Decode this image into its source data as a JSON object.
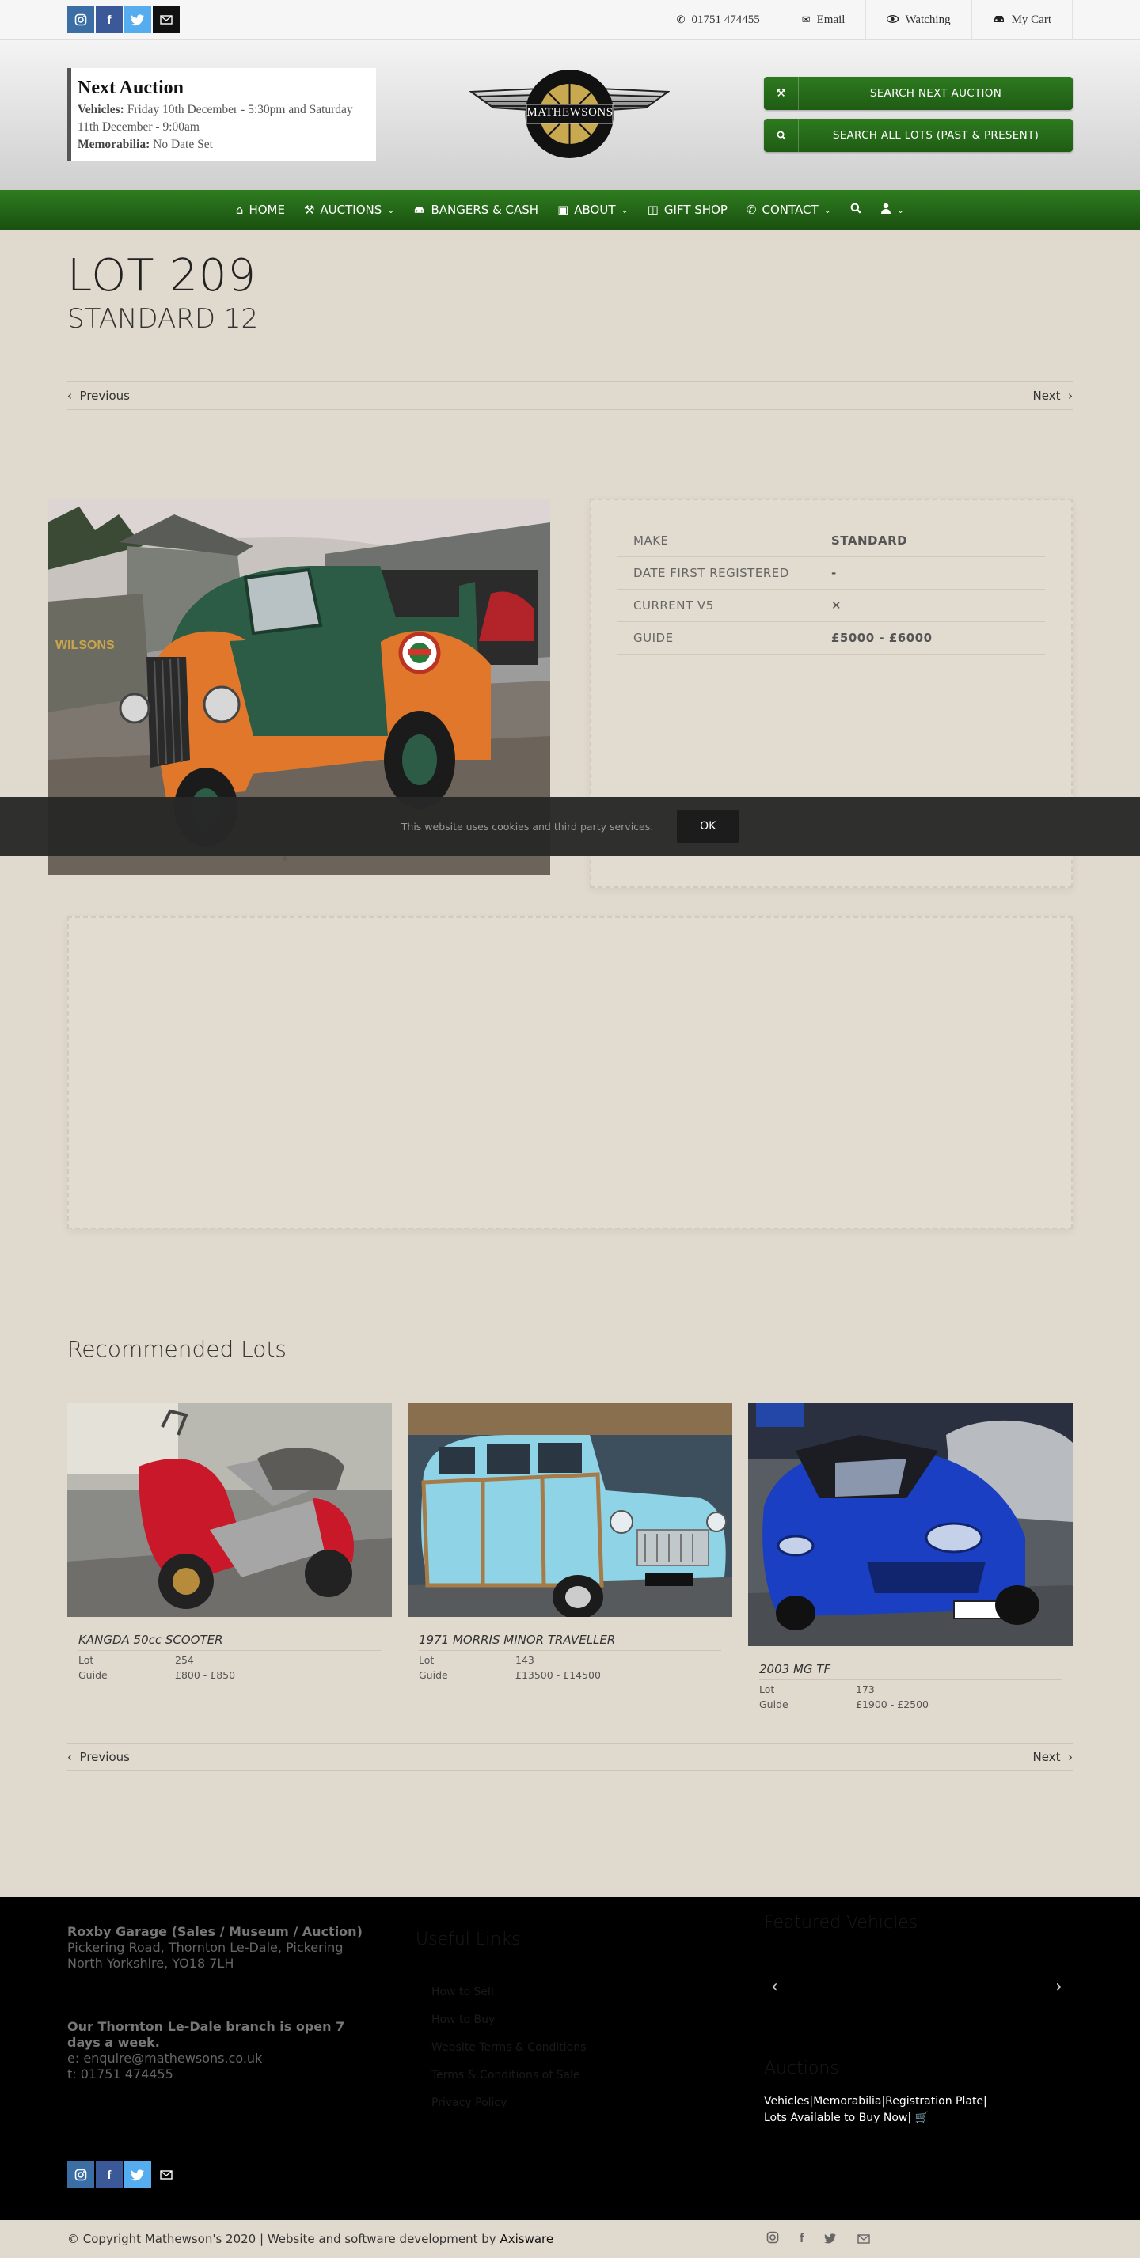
{
  "topbar": {
    "social": [
      "instagram-icon",
      "facebook-icon",
      "twitter-icon",
      "email-icon"
    ],
    "phone": "01751 474455",
    "email": "Email",
    "watching": "Watching",
    "cart": "My Cart"
  },
  "header": {
    "next_auction_title": "Next Auction",
    "vehicles_label": "Vehicles:",
    "vehicles_value": "Friday 10th December - 5:30pm and Saturday 11th December - 9:00am",
    "memorabilia_label": "Memorabilia:",
    "memorabilia_value": "No Date Set",
    "logo_text": "MATHEWSONS",
    "search_next": "SEARCH NEXT AUCTION",
    "search_all": "SEARCH ALL LOTS (PAST & PRESENT)"
  },
  "nav": {
    "home": "HOME",
    "auctions": "AUCTIONS",
    "bangers": "BANGERS & CASH",
    "about": "ABOUT",
    "gift": "GIFT SHOP",
    "contact": "CONTACT"
  },
  "lot": {
    "number": "LOT 209",
    "title": "STANDARD 12",
    "previous": "Previous",
    "next": "Next",
    "specs": [
      {
        "key": "MAKE",
        "value": "STANDARD"
      },
      {
        "key": "DATE FIRST REGISTERED",
        "value": "-"
      },
      {
        "key": "CURRENT V5",
        "value": "✕"
      },
      {
        "key": "GUIDE",
        "value": "£5000 - £6000"
      }
    ]
  },
  "cookie": {
    "text": "This website uses cookies and third party services.",
    "ok": "OK"
  },
  "recommended": {
    "title": "Recommended Lots",
    "lot_label": "Lot",
    "guide_label": "Guide",
    "items": [
      {
        "name": "KANGDA 50cc SCOOTER",
        "lot": "254",
        "guide": "£800 - £850"
      },
      {
        "name": "1971 MORRIS MINOR TRAVELLER",
        "lot": "143",
        "guide": "£13500 - £14500"
      },
      {
        "name": "2003 MG TF",
        "lot": "173",
        "guide": "£1900 - £2500"
      }
    ],
    "previous": "Previous",
    "next": "Next"
  },
  "footer": {
    "garage_title": "Roxby Garage (Sales / Museum / Auction)",
    "address": "Pickering Road, Thornton Le-Dale, Pickering North Yorkshire, YO18 7LH",
    "open_text": "Our Thornton Le-Dale branch is open 7 days a week.",
    "email_line": "e: enquire@mathewsons.co.uk",
    "phone_line": "t: 01751 474455",
    "useful_links_title": "Useful Links",
    "links": [
      "How to Sell",
      "How to Buy",
      "Website Terms & Conditions",
      "Terms & Conditions of Sale",
      "Privacy Policy"
    ],
    "featured_title": "Featured Vehicles",
    "auctions_title": "Auctions",
    "auction_links_1": "Vehicles|Memorabilia|Registration Plate|",
    "auction_links_2": "Lots Available to Buy Now|",
    "copyright": "© Copyright Mathewson's 2020 | Website and software development by ",
    "developer": "Axisware"
  },
  "colors": {
    "green": "#23691a",
    "instagram": "#3a6ea5",
    "facebook": "#3b5998",
    "twitter": "#55acee"
  }
}
